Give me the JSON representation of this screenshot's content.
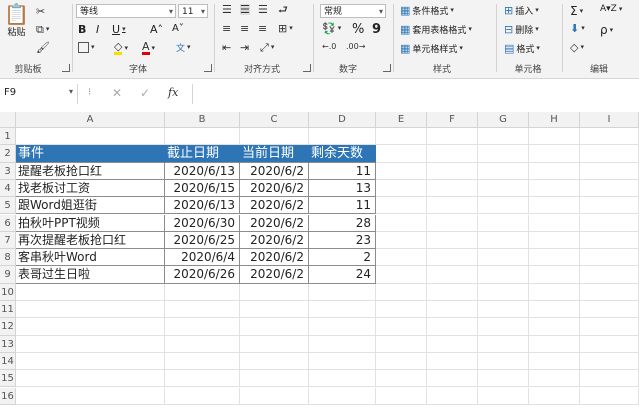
{
  "ribbon": {
    "clipboard": {
      "paste": "粘贴",
      "label": "剪贴板"
    },
    "font": {
      "name": "等线",
      "size": "11",
      "bold": "B",
      "italic": "I",
      "underline": "U",
      "grow": "A˄",
      "shrink": "A˅",
      "pinyin": "文",
      "label": "字体"
    },
    "align": {
      "label": "对齐方式"
    },
    "number": {
      "format": "常规",
      "percent": "%",
      "comma": "9",
      "label": "数字"
    },
    "styles": {
      "conditional": "条件格式",
      "table": "套用表格格式",
      "cell": "单元格样式",
      "label": "样式"
    },
    "cells": {
      "insert": "插入",
      "delete": "删除",
      "format": "格式",
      "label": "单元格"
    },
    "editing": {
      "sum": "Σ",
      "sort": "A▾Z",
      "find": "ρ",
      "label": "编辑"
    }
  },
  "formula_bar": {
    "name_box": "F9",
    "fx": "fx",
    "formula": ""
  },
  "columns": [
    "A",
    "B",
    "C",
    "D",
    "E",
    "F",
    "G",
    "H",
    "I"
  ],
  "rows": [
    "1",
    "2",
    "3",
    "4",
    "5",
    "6",
    "7",
    "8",
    "9",
    "10",
    "11",
    "12",
    "13",
    "14",
    "15",
    "16"
  ],
  "table": {
    "headers": [
      "事件",
      "截止日期",
      "当前日期",
      "剩余天数"
    ],
    "rows": [
      [
        "提醒老板抢口红",
        "2020/6/13",
        "2020/6/2",
        "11"
      ],
      [
        "找老板讨工资",
        "2020/6/15",
        "2020/6/2",
        "13"
      ],
      [
        "跟Word姐逛街",
        "2020/6/13",
        "2020/6/2",
        "11"
      ],
      [
        "拍秋叶PPT视频",
        "2020/6/30",
        "2020/6/2",
        "28"
      ],
      [
        "再次提醒老板抢口红",
        "2020/6/25",
        "2020/6/2",
        "23"
      ],
      [
        "客串秋叶Word",
        "2020/6/4",
        "2020/6/2",
        "2"
      ],
      [
        "表哥过生日啦",
        "2020/6/26",
        "2020/6/2",
        "24"
      ]
    ]
  },
  "colors": {
    "header_fill": "#2e75b6",
    "ribbon_bg": "#f3f3f3",
    "grid_line": "#e1e1e1"
  }
}
